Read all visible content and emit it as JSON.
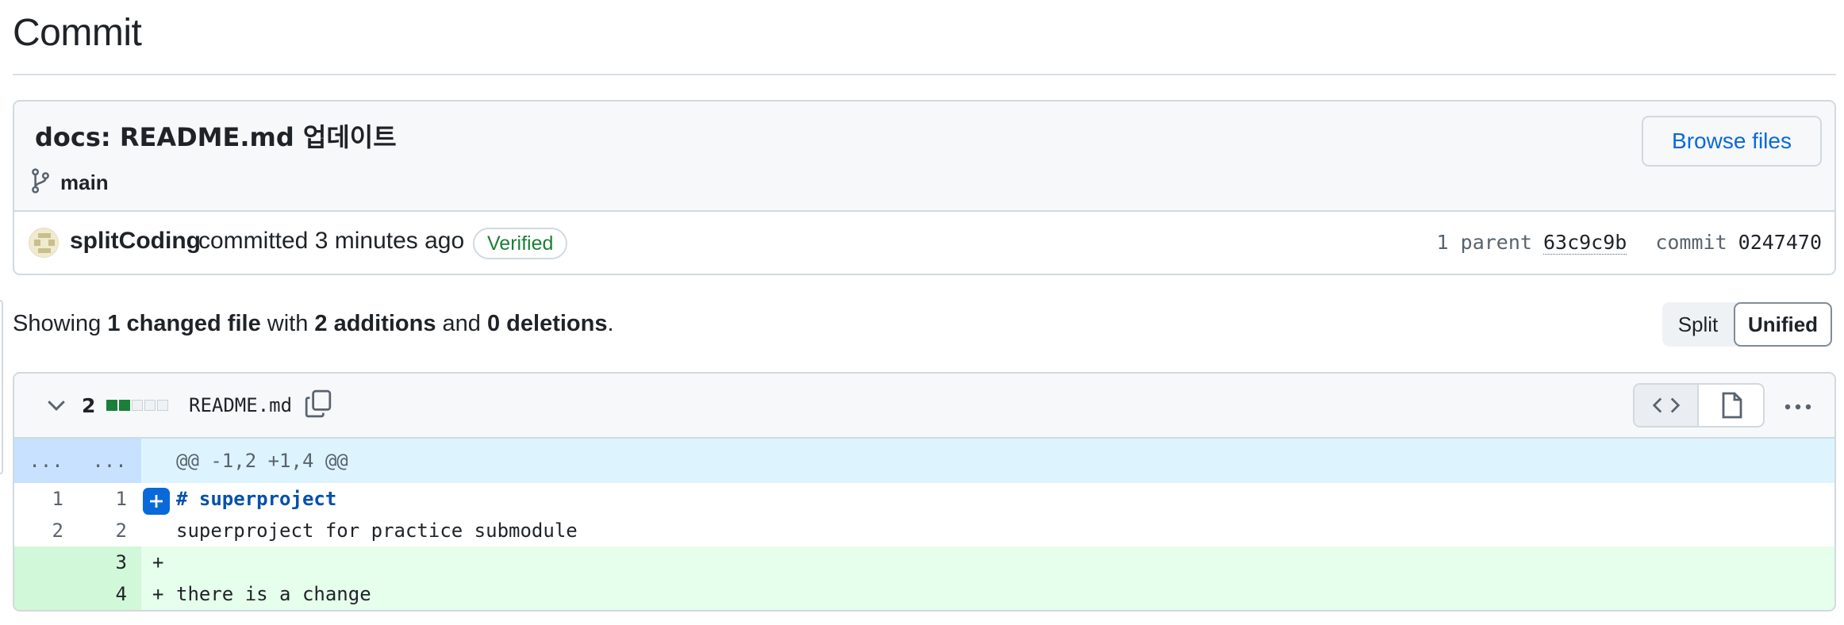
{
  "page": {
    "title": "Commit"
  },
  "commit": {
    "message": "docs: README.md 업데이트",
    "branch": "main",
    "browse_label": "Browse files",
    "author": "splitCoding",
    "committed_text": "committed 3 minutes ago",
    "verified_label": "Verified",
    "parent_label": "1 parent",
    "parent_sha": "63c9c9b",
    "commit_label": "commit",
    "commit_sha": "0247470"
  },
  "summary": {
    "prefix": "Showing",
    "changed": "1 changed file",
    "with": "with",
    "additions": "2 additions",
    "and": "and",
    "deletions": "0 deletions",
    "suffix": "."
  },
  "view_toggle": {
    "split_label": "Split",
    "unified_label": "Unified",
    "selected": "Unified"
  },
  "file": {
    "change_count": "2",
    "diffstat": [
      "add",
      "add",
      "neu",
      "neu",
      "neu"
    ],
    "name": "README.md",
    "hunk": {
      "old": "...",
      "new": "...",
      "header": "@@ -1,2 +1,4 @@"
    },
    "lines": [
      {
        "old": "1",
        "new": "1",
        "marker": "",
        "text": "# superproject",
        "type": "context-heading"
      },
      {
        "old": "2",
        "new": "2",
        "marker": "",
        "text": "superproject for practice submodule",
        "type": "context"
      },
      {
        "old": "",
        "new": "3",
        "marker": "+",
        "text": "",
        "type": "add"
      },
      {
        "old": "",
        "new": "4",
        "marker": "+",
        "text": "there is a change",
        "type": "add"
      }
    ]
  },
  "colors": {
    "accent": "#0969da",
    "verified": "#1a7f37",
    "add_bg": "#e6ffec",
    "hunk_bg": "#ddf4ff"
  },
  "icons": [
    "git-branch-icon",
    "copy-icon",
    "chevron-down-icon",
    "code-icon",
    "file-icon",
    "kebab-horizontal-icon",
    "plus-icon"
  ]
}
